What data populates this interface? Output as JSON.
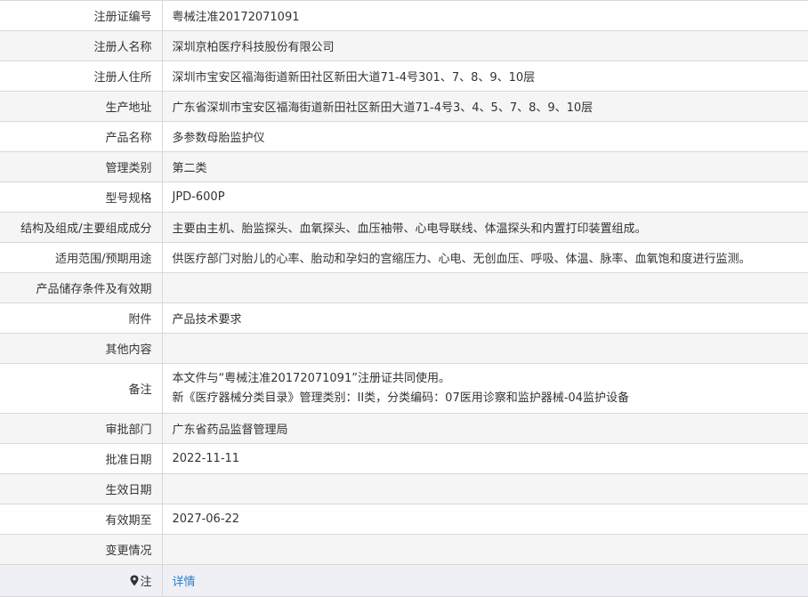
{
  "rows": [
    {
      "label": "注册证编号",
      "value": "粤械注准20172071091"
    },
    {
      "label": "注册人名称",
      "value": "深圳京柏医疗科技股份有限公司"
    },
    {
      "label": "注册人住所",
      "value": "深圳市宝安区福海街道新田社区新田大道71-4号301、7、8、9、10层"
    },
    {
      "label": "生产地址",
      "value": "广东省深圳市宝安区福海街道新田社区新田大道71-4号3、4、5、7、8、9、10层"
    },
    {
      "label": "产品名称",
      "value": "多参数母胎监护仪"
    },
    {
      "label": "管理类别",
      "value": "第二类"
    },
    {
      "label": "型号规格",
      "value": "JPD-600P"
    },
    {
      "label": "结构及组成/主要组成成分",
      "value": "主要由主机、胎监探头、血氧探头、血压袖带、心电导联线、体温探头和内置打印装置组成。"
    },
    {
      "label": "适用范围/预期用途",
      "value": "供医疗部门对胎儿的心率、胎动和孕妇的宫缩压力、心电、无创血压、呼吸、体温、脉率、血氧饱和度进行监测。"
    },
    {
      "label": "产品储存条件及有效期",
      "value": ""
    },
    {
      "label": "附件",
      "value": "产品技术要求"
    },
    {
      "label": "其他内容",
      "value": ""
    },
    {
      "label": "备注",
      "line1": "本文件与“粤械注准20172071091”注册证共同使用。",
      "line2": "新《医疗器械分类目录》管理类别：II类，分类编码：07医用诊察和监护器械-04监护设备"
    },
    {
      "label": "审批部门",
      "value": "广东省药品监督管理局"
    },
    {
      "label": "批准日期",
      "value": "2022-11-11"
    },
    {
      "label": "生效日期",
      "value": ""
    },
    {
      "label": "有效期至",
      "value": "2027-06-22"
    },
    {
      "label": "变更情况",
      "value": ""
    },
    {
      "label": "注",
      "link": "详情"
    }
  ]
}
